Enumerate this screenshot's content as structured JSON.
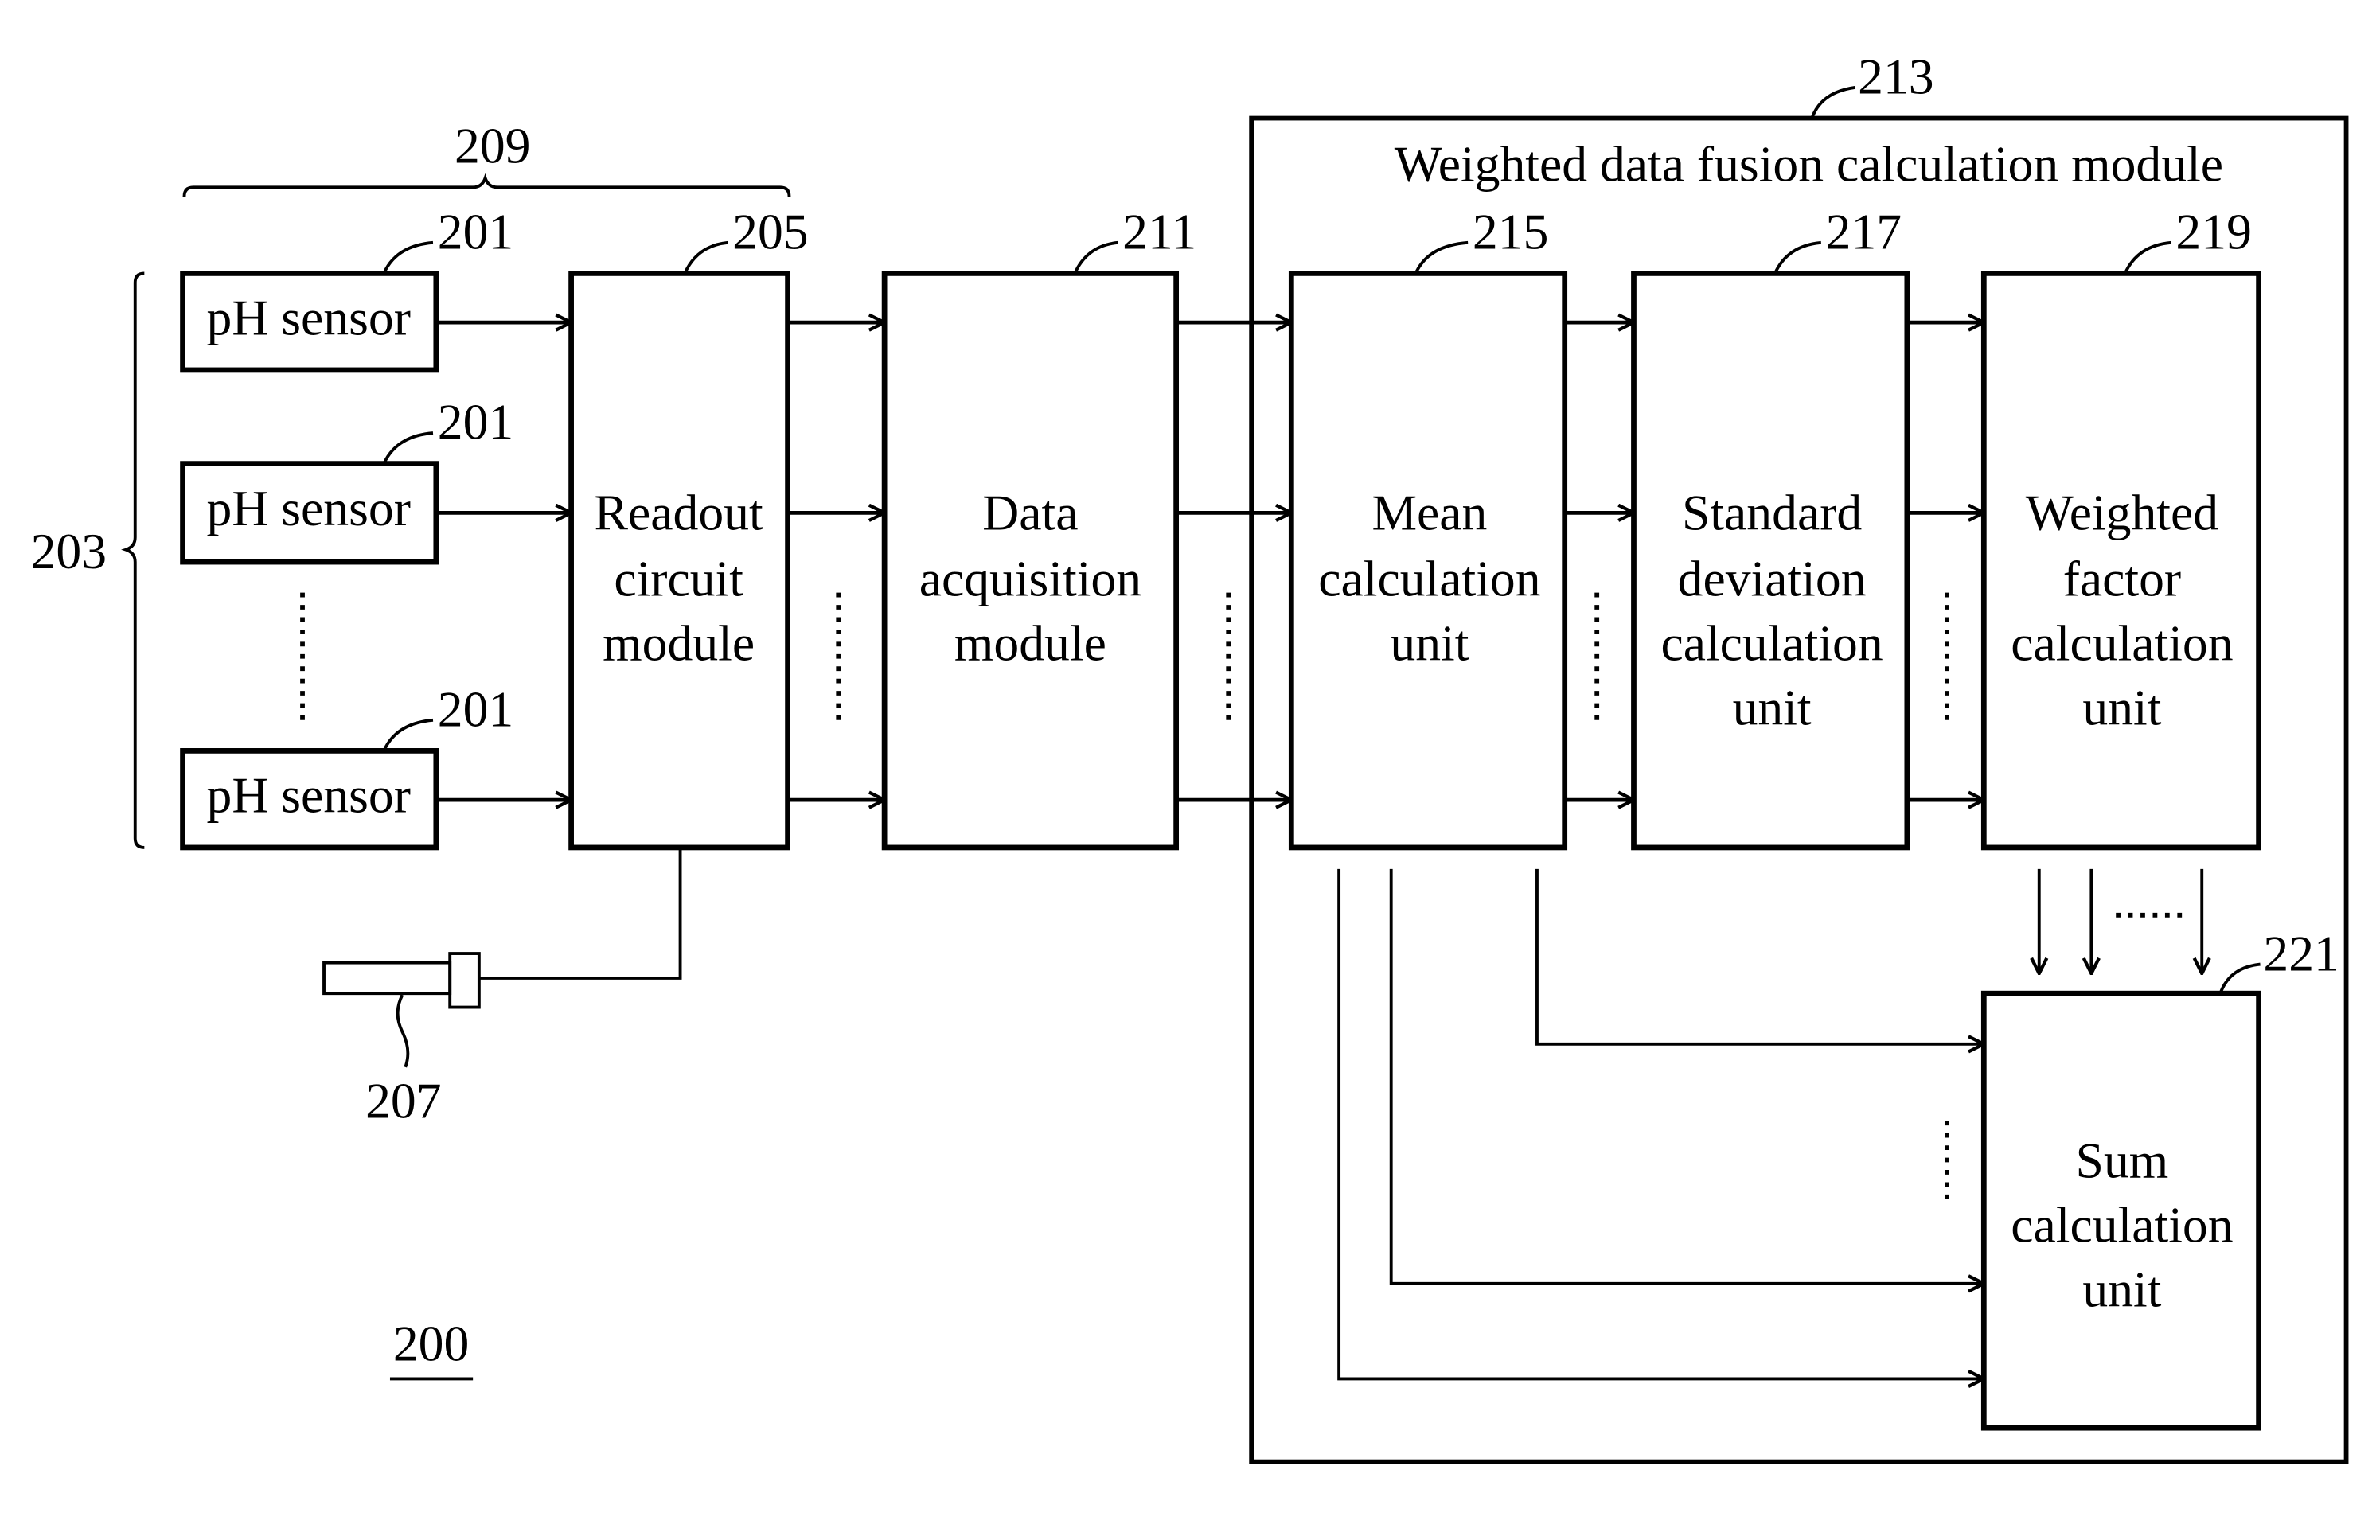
{
  "figure": {
    "figure_number": "200",
    "title_module": "Weighted data fusion calculation module",
    "ref_labels": {
      "sensor_group": "203",
      "sensor_readout_group": "209",
      "sensor_1": "201",
      "sensor_2": "201",
      "sensor_n": "201",
      "readout_module": "205",
      "reference_electrode": "207",
      "data_acquisition": "211",
      "fusion_module": "213",
      "mean_unit": "215",
      "std_unit": "217",
      "weight_unit": "219",
      "sum_unit": "221"
    },
    "sensors": [
      "pH sensor",
      "pH sensor",
      "pH sensor"
    ],
    "readout_module": [
      "Readout",
      "circuit",
      "module"
    ],
    "data_acquisition": [
      "Data",
      "acquisition",
      "module"
    ],
    "mean_unit": [
      "Mean",
      "calculation",
      "unit"
    ],
    "std_unit": [
      "Standard",
      "deviation",
      "calculation",
      "unit"
    ],
    "weight_unit": [
      "Weighted",
      "factor",
      "calculation",
      "unit"
    ],
    "sum_unit": [
      "Sum",
      "calculation",
      "unit"
    ],
    "ellipsis": "......"
  }
}
